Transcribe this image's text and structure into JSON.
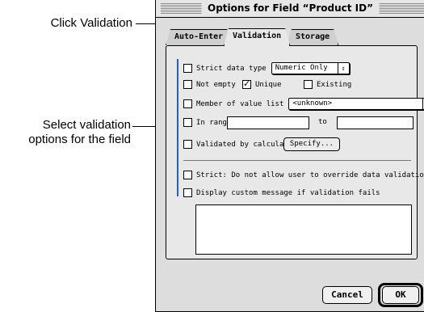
{
  "callouts": {
    "click_validation": "Click Validation",
    "select_validation_line1": "Select validation",
    "select_validation_line2": "options for the field"
  },
  "dialog": {
    "title": "Options for Field “Product ID”",
    "tabs": [
      {
        "label": "Auto-Enter",
        "selected": false
      },
      {
        "label": "Validation",
        "selected": true
      },
      {
        "label": "Storage",
        "selected": false
      }
    ],
    "strict_data_type": {
      "label": "Strict data type",
      "checked": false,
      "popup_value": "Numeric Only"
    },
    "not_empty": {
      "label": "Not empty",
      "checked": false
    },
    "unique": {
      "label": "Unique",
      "checked": true
    },
    "existing": {
      "label": "Existing",
      "checked": false
    },
    "member_of_value_list": {
      "label": "Member of value list",
      "checked": false,
      "popup_value": "<unknown>"
    },
    "in_range": {
      "label": "In range",
      "checked": false,
      "to_label": "to",
      "from_value": "",
      "to_value": ""
    },
    "validated_by_calculation": {
      "label": "Validated by calculation",
      "checked": false,
      "specify_label": "Specify..."
    },
    "strict_override": {
      "label": "Strict: Do not allow user to override data validation",
      "checked": false
    },
    "display_custom_message": {
      "label": "Display custom message if validation fails",
      "checked": false,
      "message": ""
    },
    "cancel_label": "Cancel",
    "ok_label": "OK"
  },
  "colors": {
    "accent_bar": "#1a5fd6"
  }
}
